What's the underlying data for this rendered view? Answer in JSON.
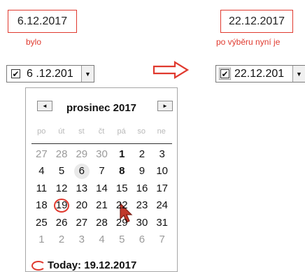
{
  "before": {
    "date_label": "6.12.2017",
    "caption": "bylo"
  },
  "after": {
    "date_label": "22.12.2017",
    "caption": "po výběru nyní je"
  },
  "picker_before": {
    "value": "6 .12.201",
    "checkbox": "✔",
    "dropdown_icon": "caret-down"
  },
  "picker_after": {
    "value": "22.12.201",
    "checkbox": "✔",
    "dropdown_icon": "caret-down"
  },
  "calendar": {
    "month": "prosinec 2017",
    "prev": "◄",
    "next": "►",
    "days_of_week": [
      "po",
      "út",
      "st",
      "čt",
      "pá",
      "so",
      "ne"
    ],
    "weeks": [
      [
        "27",
        "28",
        "29",
        "30",
        "1",
        "2",
        "3"
      ],
      [
        "4",
        "5",
        "6",
        "7",
        "8",
        "9",
        "10"
      ],
      [
        "11",
        "12",
        "13",
        "14",
        "15",
        "16",
        "17"
      ],
      [
        "18",
        "19",
        "20",
        "21",
        "22",
        "23",
        "24"
      ],
      [
        "25",
        "26",
        "27",
        "28",
        "29",
        "30",
        "31"
      ],
      [
        "1",
        "2",
        "3",
        "4",
        "5",
        "6",
        "7"
      ]
    ],
    "today_label": "Today: 19.12.2017",
    "selected": "6",
    "today": "19"
  },
  "colors": {
    "annotation_red": "#e03a2f"
  }
}
